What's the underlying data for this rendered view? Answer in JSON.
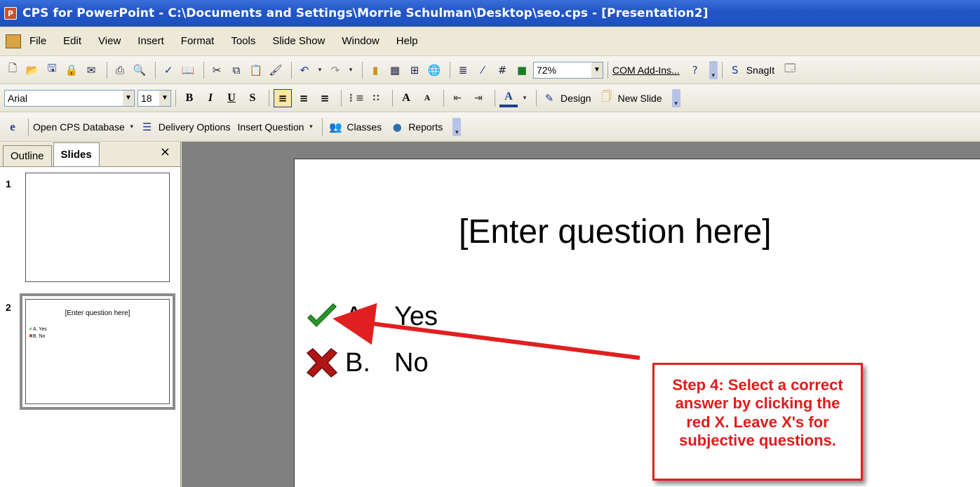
{
  "window": {
    "title": "CPS for PowerPoint - C:\\Documents and Settings\\Morrie Schulman\\Desktop\\seo.cps - [Presentation2]"
  },
  "menu": {
    "items": [
      "File",
      "Edit",
      "View",
      "Insert",
      "Format",
      "Tools",
      "Slide Show",
      "Window",
      "Help"
    ]
  },
  "toolbar_standard": {
    "zoom": "72%",
    "com_addins": "COM Add-Ins...",
    "snagit": "SnagIt"
  },
  "toolbar_formatting": {
    "font": "Arial",
    "size": "18",
    "bold": "B",
    "italic": "I",
    "underline": "U",
    "shadow": "S",
    "increase_font": "A",
    "decrease_font": "A",
    "font_color": "A",
    "design": "Design",
    "new_slide": "New Slide"
  },
  "toolbar_cps": {
    "logo": "e",
    "open_db": "Open CPS Database",
    "delivery": "Delivery Options",
    "insert_question": "Insert Question",
    "classes": "Classes",
    "reports": "Reports"
  },
  "panel": {
    "tabs": [
      "Outline",
      "Slides"
    ],
    "close": "×",
    "slides": [
      {
        "number": "1"
      },
      {
        "number": "2",
        "title": "[Enter question here]",
        "answers": [
          "A. Yes",
          "B. No"
        ]
      }
    ]
  },
  "slide": {
    "question": "[Enter question here]",
    "answers": [
      {
        "letter": "A.",
        "text": "Yes",
        "status": "correct"
      },
      {
        "letter": "B.",
        "text": "No",
        "status": "incorrect"
      }
    ]
  },
  "callout": {
    "text": "Step 4: Select a correct answer by clicking the red X. Leave X's for subjective questions."
  },
  "colors": {
    "title_bar": "#2357c8",
    "callout_red": "#e01b1b",
    "check_green": "#2a9a2a",
    "x_red": "#b01515"
  }
}
